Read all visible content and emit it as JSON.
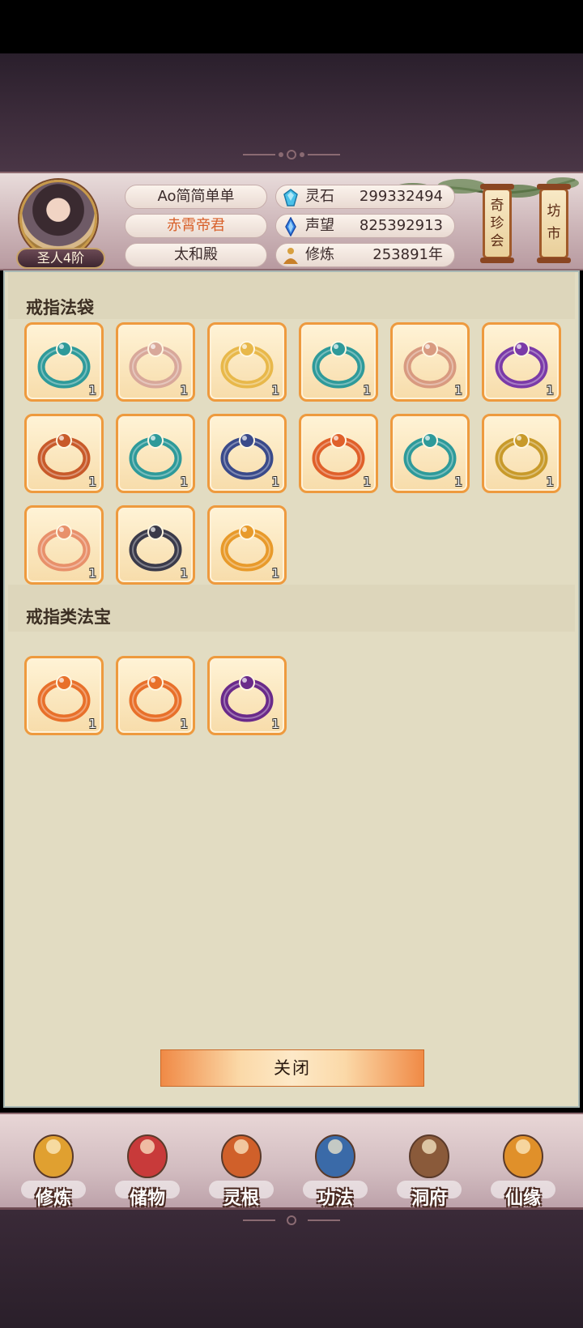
{
  "header": {
    "player_name": "Ao简简单单",
    "title": "赤霄帝君",
    "sect": "太和殿",
    "rank": "圣人4阶",
    "resources": [
      {
        "label": "灵石",
        "value": "299332494",
        "icon": "spirit-stone-icon"
      },
      {
        "label": "声望",
        "value": "825392913",
        "icon": "prestige-crystal-icon"
      },
      {
        "label": "修炼",
        "value": "253891年",
        "icon": "meditation-icon"
      }
    ],
    "side_buttons": [
      {
        "label": "奇珍会"
      },
      {
        "label": "坊市"
      }
    ]
  },
  "sections": [
    {
      "title": "戒指法袋",
      "items": [
        {
          "icon": "teal-gem-ring-icon",
          "count": "1",
          "color": "#2e9a9a"
        },
        {
          "icon": "rose-silver-ring-icon",
          "count": "1",
          "color": "#d8a89a"
        },
        {
          "icon": "gold-band-ring-icon",
          "count": "1",
          "color": "#e8b84a"
        },
        {
          "icon": "teal-pearl-ring-icon",
          "count": "1",
          "color": "#2e9a9a"
        },
        {
          "icon": "copper-ring-icon",
          "count": "1",
          "color": "#d89a80"
        },
        {
          "icon": "purple-dragon-ring-icon",
          "count": "1",
          "color": "#7a3aa8"
        },
        {
          "icon": "red-dragon-ring-icon",
          "count": "1",
          "color": "#c85a2a"
        },
        {
          "icon": "teal-pearl-ring-icon",
          "count": "1",
          "color": "#2e9a9a"
        },
        {
          "icon": "blue-spirit-ring-icon",
          "count": "1",
          "color": "#3a4a8a"
        },
        {
          "icon": "fire-serpent-ring-icon",
          "count": "1",
          "color": "#e0602a"
        },
        {
          "icon": "teal-pearl-ring-icon",
          "count": "1",
          "color": "#2e9a9a"
        },
        {
          "icon": "golden-dragon-ring-icon",
          "count": "1",
          "color": "#c89a2a"
        },
        {
          "icon": "pink-dragon-ring-icon",
          "count": "1",
          "color": "#e8906a"
        },
        {
          "icon": "violet-pearl-ring-icon",
          "count": "1",
          "color": "#3a3a4a"
        },
        {
          "icon": "jade-gold-ring-icon",
          "count": "1",
          "color": "#e89a2a"
        }
      ]
    },
    {
      "title": "戒指类法宝",
      "items": [
        {
          "icon": "orange-treasure-ring-icon",
          "count": "1",
          "color": "#e8702a"
        },
        {
          "icon": "orange-treasure-ring-icon",
          "count": "1",
          "color": "#e8702a"
        },
        {
          "icon": "dark-purple-dragon-ring-icon",
          "count": "1",
          "color": "#6a2a8a"
        }
      ]
    }
  ],
  "close_label": "关闭",
  "nav": [
    {
      "label": "修炼",
      "icon": "meditation-figure-icon",
      "color": "#e0a030"
    },
    {
      "label": "储物",
      "icon": "storage-bag-icon",
      "color": "#c83a3a"
    },
    {
      "label": "灵根",
      "icon": "spirit-root-icon",
      "color": "#d0602a"
    },
    {
      "label": "功法",
      "icon": "technique-book-icon",
      "color": "#3a6aa8"
    },
    {
      "label": "洞府",
      "icon": "cave-mansion-icon",
      "color": "#8a5a3a"
    },
    {
      "label": "仙缘",
      "icon": "immortal-fate-icon",
      "color": "#e0902a"
    }
  ]
}
